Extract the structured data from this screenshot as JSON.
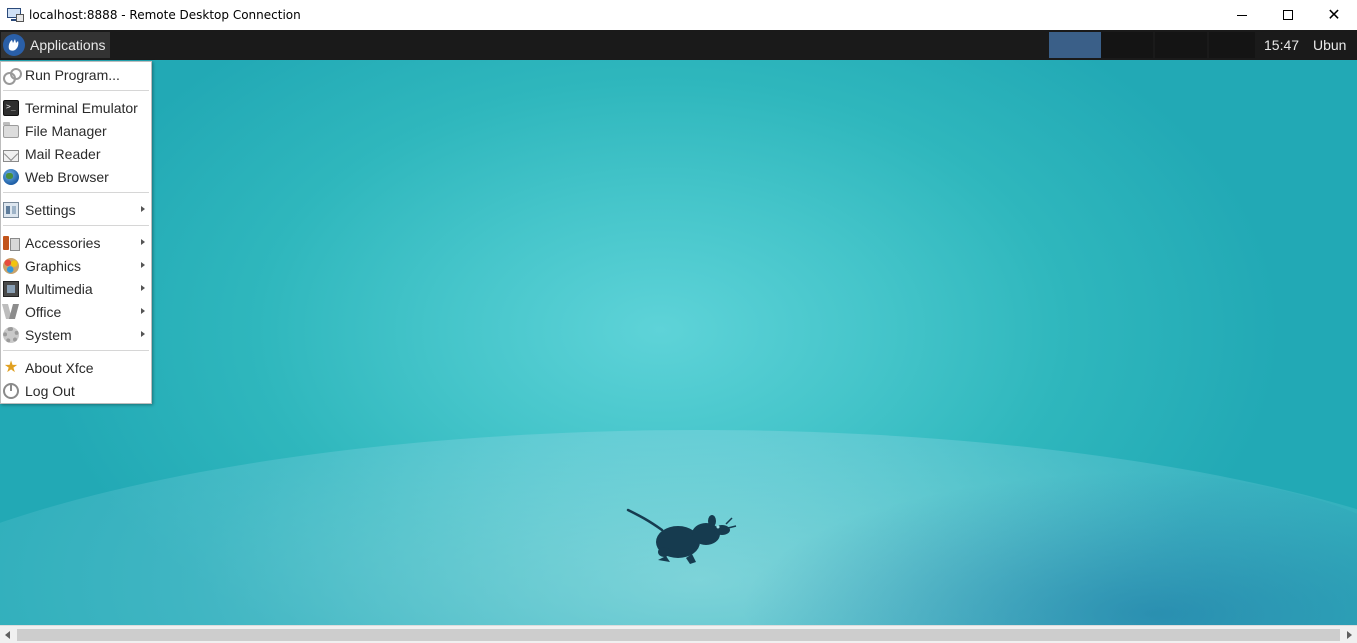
{
  "window": {
    "title": "localhost:8888 - Remote Desktop Connection",
    "minimize_icon": "minimize-icon",
    "maximize_icon": "maximize-icon",
    "close_glyph": "✕"
  },
  "panel": {
    "apps_label": "Applications",
    "clock": "15:47",
    "user": "Ubun"
  },
  "menu": {
    "items": [
      {
        "label": "Run Program...",
        "icon": "run-icon"
      },
      {
        "label": "Terminal Emulator",
        "icon": "terminal-icon"
      },
      {
        "label": "File Manager",
        "icon": "folder-icon"
      },
      {
        "label": "Mail Reader",
        "icon": "mail-icon"
      },
      {
        "label": "Web Browser",
        "icon": "globe-icon"
      },
      {
        "label": "Settings",
        "icon": "settings-icon",
        "submenu": true
      },
      {
        "label": "Accessories",
        "icon": "accessories-icon",
        "submenu": true
      },
      {
        "label": "Graphics",
        "icon": "graphics-icon",
        "submenu": true
      },
      {
        "label": "Multimedia",
        "icon": "multimedia-icon",
        "submenu": true
      },
      {
        "label": "Office",
        "icon": "office-icon",
        "submenu": true
      },
      {
        "label": "System",
        "icon": "system-icon",
        "submenu": true
      },
      {
        "label": "About Xfce",
        "icon": "star-icon"
      },
      {
        "label": "Log Out",
        "icon": "power-icon"
      }
    ]
  },
  "colors": {
    "panel_bg": "#1a1a1a",
    "desktop_teal": "#2fb7bd",
    "active_workspace": "#3a5f88",
    "mascot": "#163b4f"
  }
}
